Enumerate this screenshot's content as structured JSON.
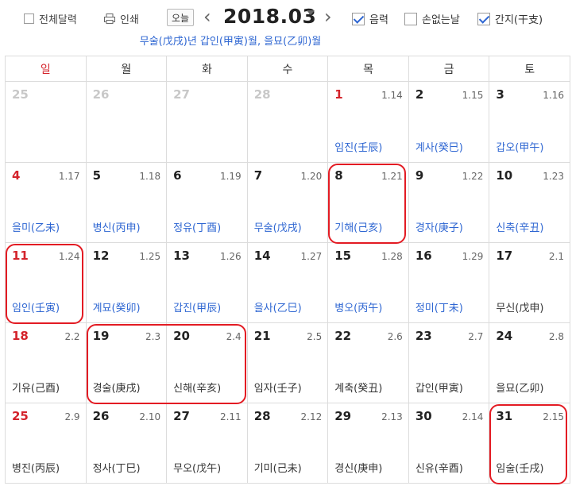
{
  "toolbar": {
    "full_calendar_label": "전체달력",
    "print_label": "인쇄",
    "today_label": "오늘",
    "month_title": "2018.03",
    "lunar_label": "음력",
    "lunar_checked": true,
    "no_loss_label": "손없는날",
    "no_loss_checked": false,
    "ganji_label": "간지(干支)",
    "ganji_checked": true
  },
  "ganji_summary": "무술(戊戌)년 갑인(甲寅)월, 을묘(乙卯)월",
  "weekdays": [
    "일",
    "월",
    "화",
    "수",
    "목",
    "금",
    "토"
  ],
  "weeks": [
    [
      {
        "day": "25",
        "lunar": "",
        "gz": "",
        "state": "other"
      },
      {
        "day": "26",
        "lunar": "",
        "gz": "",
        "state": "other"
      },
      {
        "day": "27",
        "lunar": "",
        "gz": "",
        "state": "other"
      },
      {
        "day": "28",
        "lunar": "",
        "gz": "",
        "state": "other"
      },
      {
        "day": "1",
        "lunar": "1.14",
        "gz": "임진(壬辰)",
        "state": "holiday"
      },
      {
        "day": "2",
        "lunar": "1.15",
        "gz": "계사(癸巳)",
        "state": ""
      },
      {
        "day": "3",
        "lunar": "1.16",
        "gz": "갑오(甲午)",
        "state": ""
      }
    ],
    [
      {
        "day": "4",
        "lunar": "1.17",
        "gz": "을미(乙未)",
        "state": "sun"
      },
      {
        "day": "5",
        "lunar": "1.18",
        "gz": "병신(丙申)",
        "state": ""
      },
      {
        "day": "6",
        "lunar": "1.19",
        "gz": "정유(丁酉)",
        "state": ""
      },
      {
        "day": "7",
        "lunar": "1.20",
        "gz": "무술(戊戌)",
        "state": ""
      },
      {
        "day": "8",
        "lunar": "1.21",
        "gz": "기해(己亥)",
        "state": "",
        "marked": true
      },
      {
        "day": "9",
        "lunar": "1.22",
        "gz": "경자(庚子)",
        "state": ""
      },
      {
        "day": "10",
        "lunar": "1.23",
        "gz": "신축(辛丑)",
        "state": ""
      }
    ],
    [
      {
        "day": "11",
        "lunar": "1.24",
        "gz": "임인(壬寅)",
        "state": "sun",
        "marked": true
      },
      {
        "day": "12",
        "lunar": "1.25",
        "gz": "계묘(癸卯)",
        "state": ""
      },
      {
        "day": "13",
        "lunar": "1.26",
        "gz": "갑진(甲辰)",
        "state": ""
      },
      {
        "day": "14",
        "lunar": "1.27",
        "gz": "을사(乙巳)",
        "state": ""
      },
      {
        "day": "15",
        "lunar": "1.28",
        "gz": "병오(丙午)",
        "state": ""
      },
      {
        "day": "16",
        "lunar": "1.29",
        "gz": "정미(丁未)",
        "state": ""
      },
      {
        "day": "17",
        "lunar": "2.1",
        "gz": "무신(戊申)",
        "state": "",
        "plain": true
      }
    ],
    [
      {
        "day": "18",
        "lunar": "2.2",
        "gz": "기유(己酉)",
        "state": "sun",
        "plain": true
      },
      {
        "day": "19",
        "lunar": "2.3",
        "gz": "경술(庚戌)",
        "state": "",
        "plain": true
      },
      {
        "day": "20",
        "lunar": "2.4",
        "gz": "신해(辛亥)",
        "state": "",
        "plain": true
      },
      {
        "day": "21",
        "lunar": "2.5",
        "gz": "임자(壬子)",
        "state": "",
        "plain": true
      },
      {
        "day": "22",
        "lunar": "2.6",
        "gz": "계축(癸丑)",
        "state": "",
        "plain": true
      },
      {
        "day": "23",
        "lunar": "2.7",
        "gz": "갑인(甲寅)",
        "state": "",
        "plain": true
      },
      {
        "day": "24",
        "lunar": "2.8",
        "gz": "을묘(乙卯)",
        "state": "",
        "plain": true
      }
    ],
    [
      {
        "day": "25",
        "lunar": "2.9",
        "gz": "병진(丙辰)",
        "state": "sun",
        "plain": true
      },
      {
        "day": "26",
        "lunar": "2.10",
        "gz": "정사(丁巳)",
        "state": "",
        "plain": true
      },
      {
        "day": "27",
        "lunar": "2.11",
        "gz": "무오(戊午)",
        "state": "",
        "plain": true
      },
      {
        "day": "28",
        "lunar": "2.12",
        "gz": "기미(己未)",
        "state": "",
        "plain": true
      },
      {
        "day": "29",
        "lunar": "2.13",
        "gz": "경신(庚申)",
        "state": "",
        "plain": true
      },
      {
        "day": "30",
        "lunar": "2.14",
        "gz": "신유(辛酉)",
        "state": "",
        "plain": true
      },
      {
        "day": "31",
        "lunar": "2.15",
        "gz": "임술(壬戌)",
        "state": "",
        "plain": true,
        "marked": true
      }
    ]
  ],
  "colors": {
    "sunday_red": "#d4232b",
    "ganji_blue": "#2e66d2",
    "marker_red": "#e31b23"
  }
}
